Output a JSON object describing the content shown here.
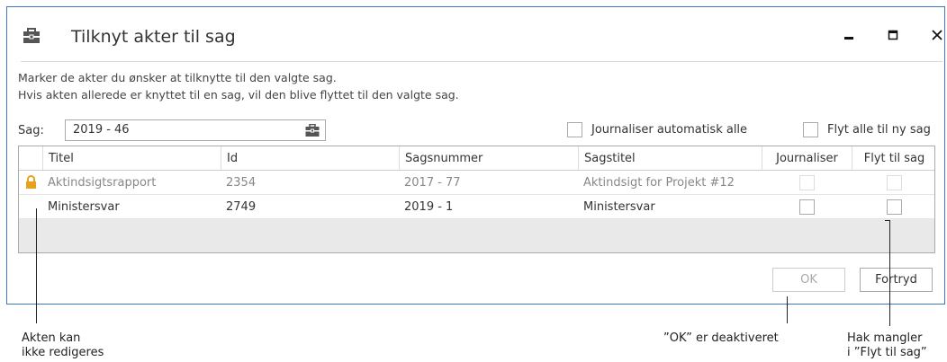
{
  "window": {
    "title": "Tilknyt akter til sag",
    "minimize_icon": "minimize-icon",
    "maximize_icon": "maximize-icon",
    "close_icon": "close-icon"
  },
  "info": {
    "line1": "Marker de akter du ønsker at tilknytte til den valgte sag.",
    "line2": "Hvis akten allerede er knyttet til en sag, vil den blive flyttet til den valgte sag."
  },
  "sag": {
    "label": "Sag:",
    "value": "2019 - 46"
  },
  "options": {
    "journaliser_all": "Journaliser automatisk alle",
    "move_all": "Flyt alle til ny sag"
  },
  "table": {
    "columns": [
      "Titel",
      "Id",
      "Sagsnummer",
      "Sagstitel",
      "Journaliser",
      "Flyt til sag"
    ],
    "rows": [
      {
        "locked": true,
        "titel": "Aktindsigtsrapport",
        "id": "2354",
        "sagsnummer": "2017 - 77",
        "sagstitel": "Aktindsigt for Projekt #12"
      },
      {
        "locked": false,
        "titel": "Ministersvar",
        "id": "2749",
        "sagsnummer": "2019 - 1",
        "sagstitel": "Ministersvar"
      }
    ]
  },
  "buttons": {
    "ok": "OK",
    "cancel": "Fortryd"
  },
  "callouts": {
    "lock_line1": "Akten kan",
    "lock_line2": "ikke redigeres",
    "ok": "”OK” er deaktiveret",
    "check_line1": "Hak mangler",
    "check_line2": "i ”Flyt til sag”"
  },
  "colors": {
    "window_border": "#3c78c0",
    "lock": "#e8a020",
    "grid_empty": "#e9e9e9"
  }
}
